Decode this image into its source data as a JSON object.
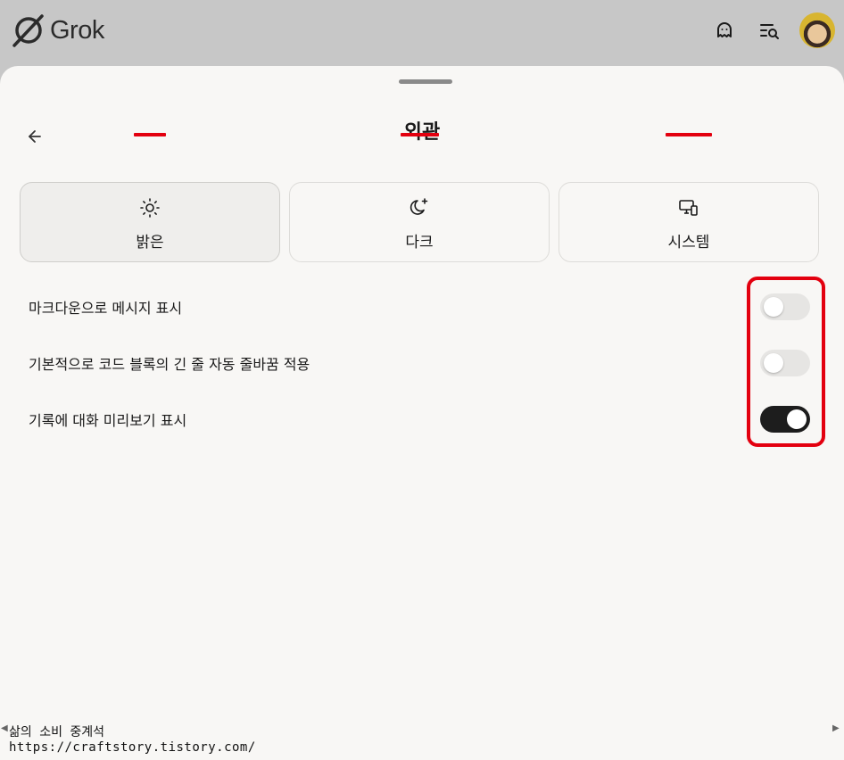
{
  "app": {
    "name": "Grok"
  },
  "topbar": {
    "icons": [
      "ghost-icon",
      "history-search-icon"
    ],
    "avatar": "user-avatar"
  },
  "sheet": {
    "title": "외관",
    "back_icon": "arrow-left-icon"
  },
  "themes": [
    {
      "label": "밝은",
      "icon": "sun-icon",
      "selected": true
    },
    {
      "label": "다크",
      "icon": "moon-sparkle-icon",
      "selected": false
    },
    {
      "label": "시스템",
      "icon": "devices-icon",
      "selected": false
    }
  ],
  "settings": [
    {
      "label": "마크다운으로 메시지 표시",
      "enabled": false
    },
    {
      "label": "기본적으로 코드 블록의 긴 줄 자동 줄바꿈 적용",
      "enabled": false
    },
    {
      "label": "기록에 대화 미리보기 표시",
      "enabled": true
    }
  ],
  "watermark": {
    "line1": "삶의 소비 중계석",
    "line2": "https://craftstory.tistory.com/"
  },
  "colors": {
    "annotation_red": "#e3000f",
    "toggle_on": "#1d1d1d",
    "toggle_off": "#e6e5e3",
    "sheet_bg": "#f8f7f5",
    "topbar_bg": "#c7c7c7"
  }
}
